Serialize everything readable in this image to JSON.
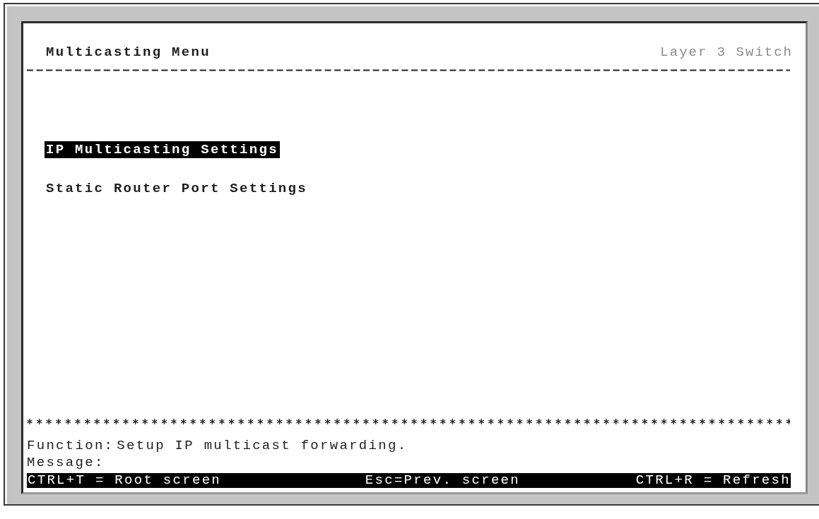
{
  "header": {
    "title": "Multicasting Menu",
    "product": "Layer 3 Switch"
  },
  "menu_items": [
    {
      "label": "IP Multicasting Settings",
      "selected": true
    },
    {
      "label": "Static Router Port Settings",
      "selected": false
    }
  ],
  "function": {
    "label": "Function:",
    "text": "Setup IP multicast forwarding."
  },
  "message": {
    "label": "Message:"
  },
  "key_bar": [
    "CTRL+T = Root screen",
    "Esc=Prev. screen",
    "CTRL+R = Refresh"
  ]
}
